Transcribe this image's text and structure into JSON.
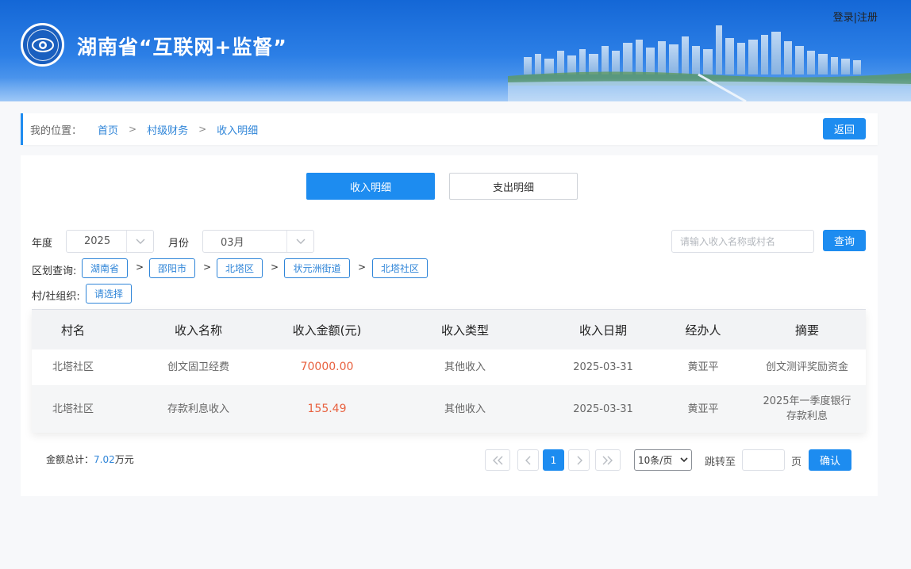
{
  "header": {
    "site_title": "湖南省“互联网+监督”",
    "login_label": "登录",
    "divider": "|",
    "register_label": "注册",
    "colors": {
      "header_blue": "#1467d6",
      "accent": "#1d8cf0"
    }
  },
  "breadcrumb": {
    "label": "我的位置：",
    "items": [
      "首页",
      "村级财务",
      "收入明细"
    ],
    "separator": ">",
    "back_label": "返回"
  },
  "tabs": [
    {
      "label": "收入明细",
      "active": true
    },
    {
      "label": "支出明细",
      "active": false
    }
  ],
  "filters": {
    "year_label": "年度",
    "year_value": "2025",
    "month_label": "月份",
    "month_value": "03月",
    "search_placeholder": "请输入收入名称或村名",
    "query_label": "查询",
    "region_label": "区划查询:",
    "region_chips": [
      "湖南省",
      "邵阳市",
      "北塔区",
      "状元洲街道",
      "北塔社区"
    ],
    "region_separator": ">",
    "org_label": "村/社组织:",
    "org_button": "请选择"
  },
  "table": {
    "headers": [
      "村名",
      "收入名称",
      "收入金额(元)",
      "收入类型",
      "收入日期",
      "经办人",
      "摘要"
    ],
    "rows": [
      [
        "北塔社区",
        "创文固卫经费",
        "70000.00",
        "其他收入",
        "2025-03-31",
        "黄亚平",
        "创文测评奖励资金"
      ],
      [
        "北塔社区",
        "存款利息收入",
        "155.49",
        "其他收入",
        "2025-03-31",
        "黄亚平",
        "2025年一季度银行存款利息"
      ]
    ]
  },
  "footer": {
    "total_label": "金额总计：",
    "total_value": "7.02",
    "total_unit": "万元",
    "current_page": "1",
    "page_size": "10条/页",
    "jump_label": "跳转至",
    "page_unit": "页",
    "confirm_label": "确认"
  },
  "icons": [
    "logo-emblem",
    "chevron-down-icon",
    "first-page-icon",
    "prev-page-icon",
    "next-page-icon",
    "last-page-icon"
  ]
}
